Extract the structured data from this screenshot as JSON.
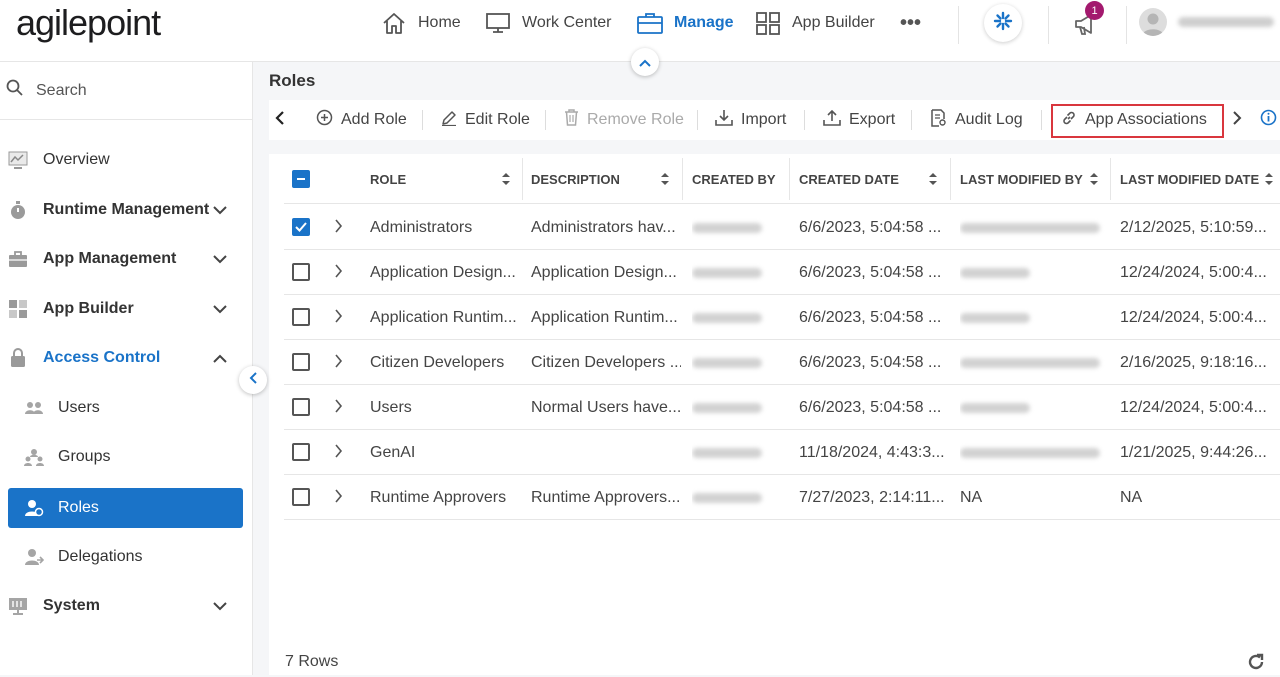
{
  "brand": {
    "logo_text": "agilepoint"
  },
  "topnav": {
    "items": [
      {
        "label": "Home",
        "icon": "home-icon"
      },
      {
        "label": "Work Center",
        "icon": "monitor-icon"
      },
      {
        "label": "Manage",
        "icon": "briefcase-icon",
        "active": true
      },
      {
        "label": "App Builder",
        "icon": "grid-icon"
      }
    ],
    "more_label": "•••",
    "notification_count": "1"
  },
  "sidebar": {
    "search_label": "Search",
    "items": [
      {
        "label": "Overview",
        "icon": "chart-icon"
      },
      {
        "label": "Runtime Management",
        "icon": "stopwatch-icon"
      },
      {
        "label": "App Management",
        "icon": "briefcase-icon"
      },
      {
        "label": "App Builder",
        "icon": "grid-icon"
      },
      {
        "label": "Access Control",
        "icon": "lock-icon"
      },
      {
        "label": "Users",
        "icon": "users-icon"
      },
      {
        "label": "Groups",
        "icon": "groups-icon"
      },
      {
        "label": "Roles",
        "icon": "roles-icon"
      },
      {
        "label": "Delegations",
        "icon": "delegations-icon"
      },
      {
        "label": "System",
        "icon": "system-icon"
      }
    ]
  },
  "page": {
    "title": "Roles"
  },
  "toolbar": {
    "add_role": "Add Role",
    "edit_role": "Edit Role",
    "remove_role": "Remove Role",
    "import": "Import",
    "export": "Export",
    "audit_log": "Audit Log",
    "app_associations": "App Associations"
  },
  "table": {
    "columns": [
      "ROLE",
      "DESCRIPTION",
      "CREATED BY",
      "CREATED DATE",
      "LAST MODIFIED BY",
      "LAST MODIFIED DATE"
    ],
    "rows": [
      {
        "role": "Administrators",
        "description": "Administrators hav...",
        "created_date": "6/6/2023, 5:04:58 ...",
        "last_modified_by": "",
        "last_modified_date": "2/12/2025, 5:10:59...",
        "checked": true
      },
      {
        "role": "Application Design...",
        "description": "Application Design...",
        "created_date": "6/6/2023, 5:04:58 ...",
        "last_modified_by": "",
        "last_modified_date": "12/24/2024, 5:00:4...",
        "checked": false
      },
      {
        "role": "Application Runtim...",
        "description": "Application Runtim...",
        "created_date": "6/6/2023, 5:04:58 ...",
        "last_modified_by": "",
        "last_modified_date": "12/24/2024, 5:00:4...",
        "checked": false
      },
      {
        "role": "Citizen Developers",
        "description": "Citizen Developers ...",
        "created_date": "6/6/2023, 5:04:58 ...",
        "last_modified_by": "",
        "last_modified_date": "2/16/2025, 9:18:16...",
        "checked": false
      },
      {
        "role": "Users",
        "description": "Normal Users have...",
        "created_date": "6/6/2023, 5:04:58 ...",
        "last_modified_by": "",
        "last_modified_date": "12/24/2024, 5:00:4...",
        "checked": false
      },
      {
        "role": "GenAI",
        "description": "",
        "created_date": "11/18/2024, 4:43:3...",
        "last_modified_by": "",
        "last_modified_date": "1/21/2025, 9:44:26...",
        "checked": false
      },
      {
        "role": "Runtime Approvers",
        "description": "Runtime Approvers...",
        "created_date": "7/27/2023, 2:14:11...",
        "last_modified_by": "NA",
        "last_modified_date": "NA",
        "checked": false
      }
    ]
  },
  "footer": {
    "row_count": "7 Rows"
  },
  "colors": {
    "accent": "#1a73c8",
    "highlight_border": "#d9363e",
    "badge": "#a3196e"
  }
}
